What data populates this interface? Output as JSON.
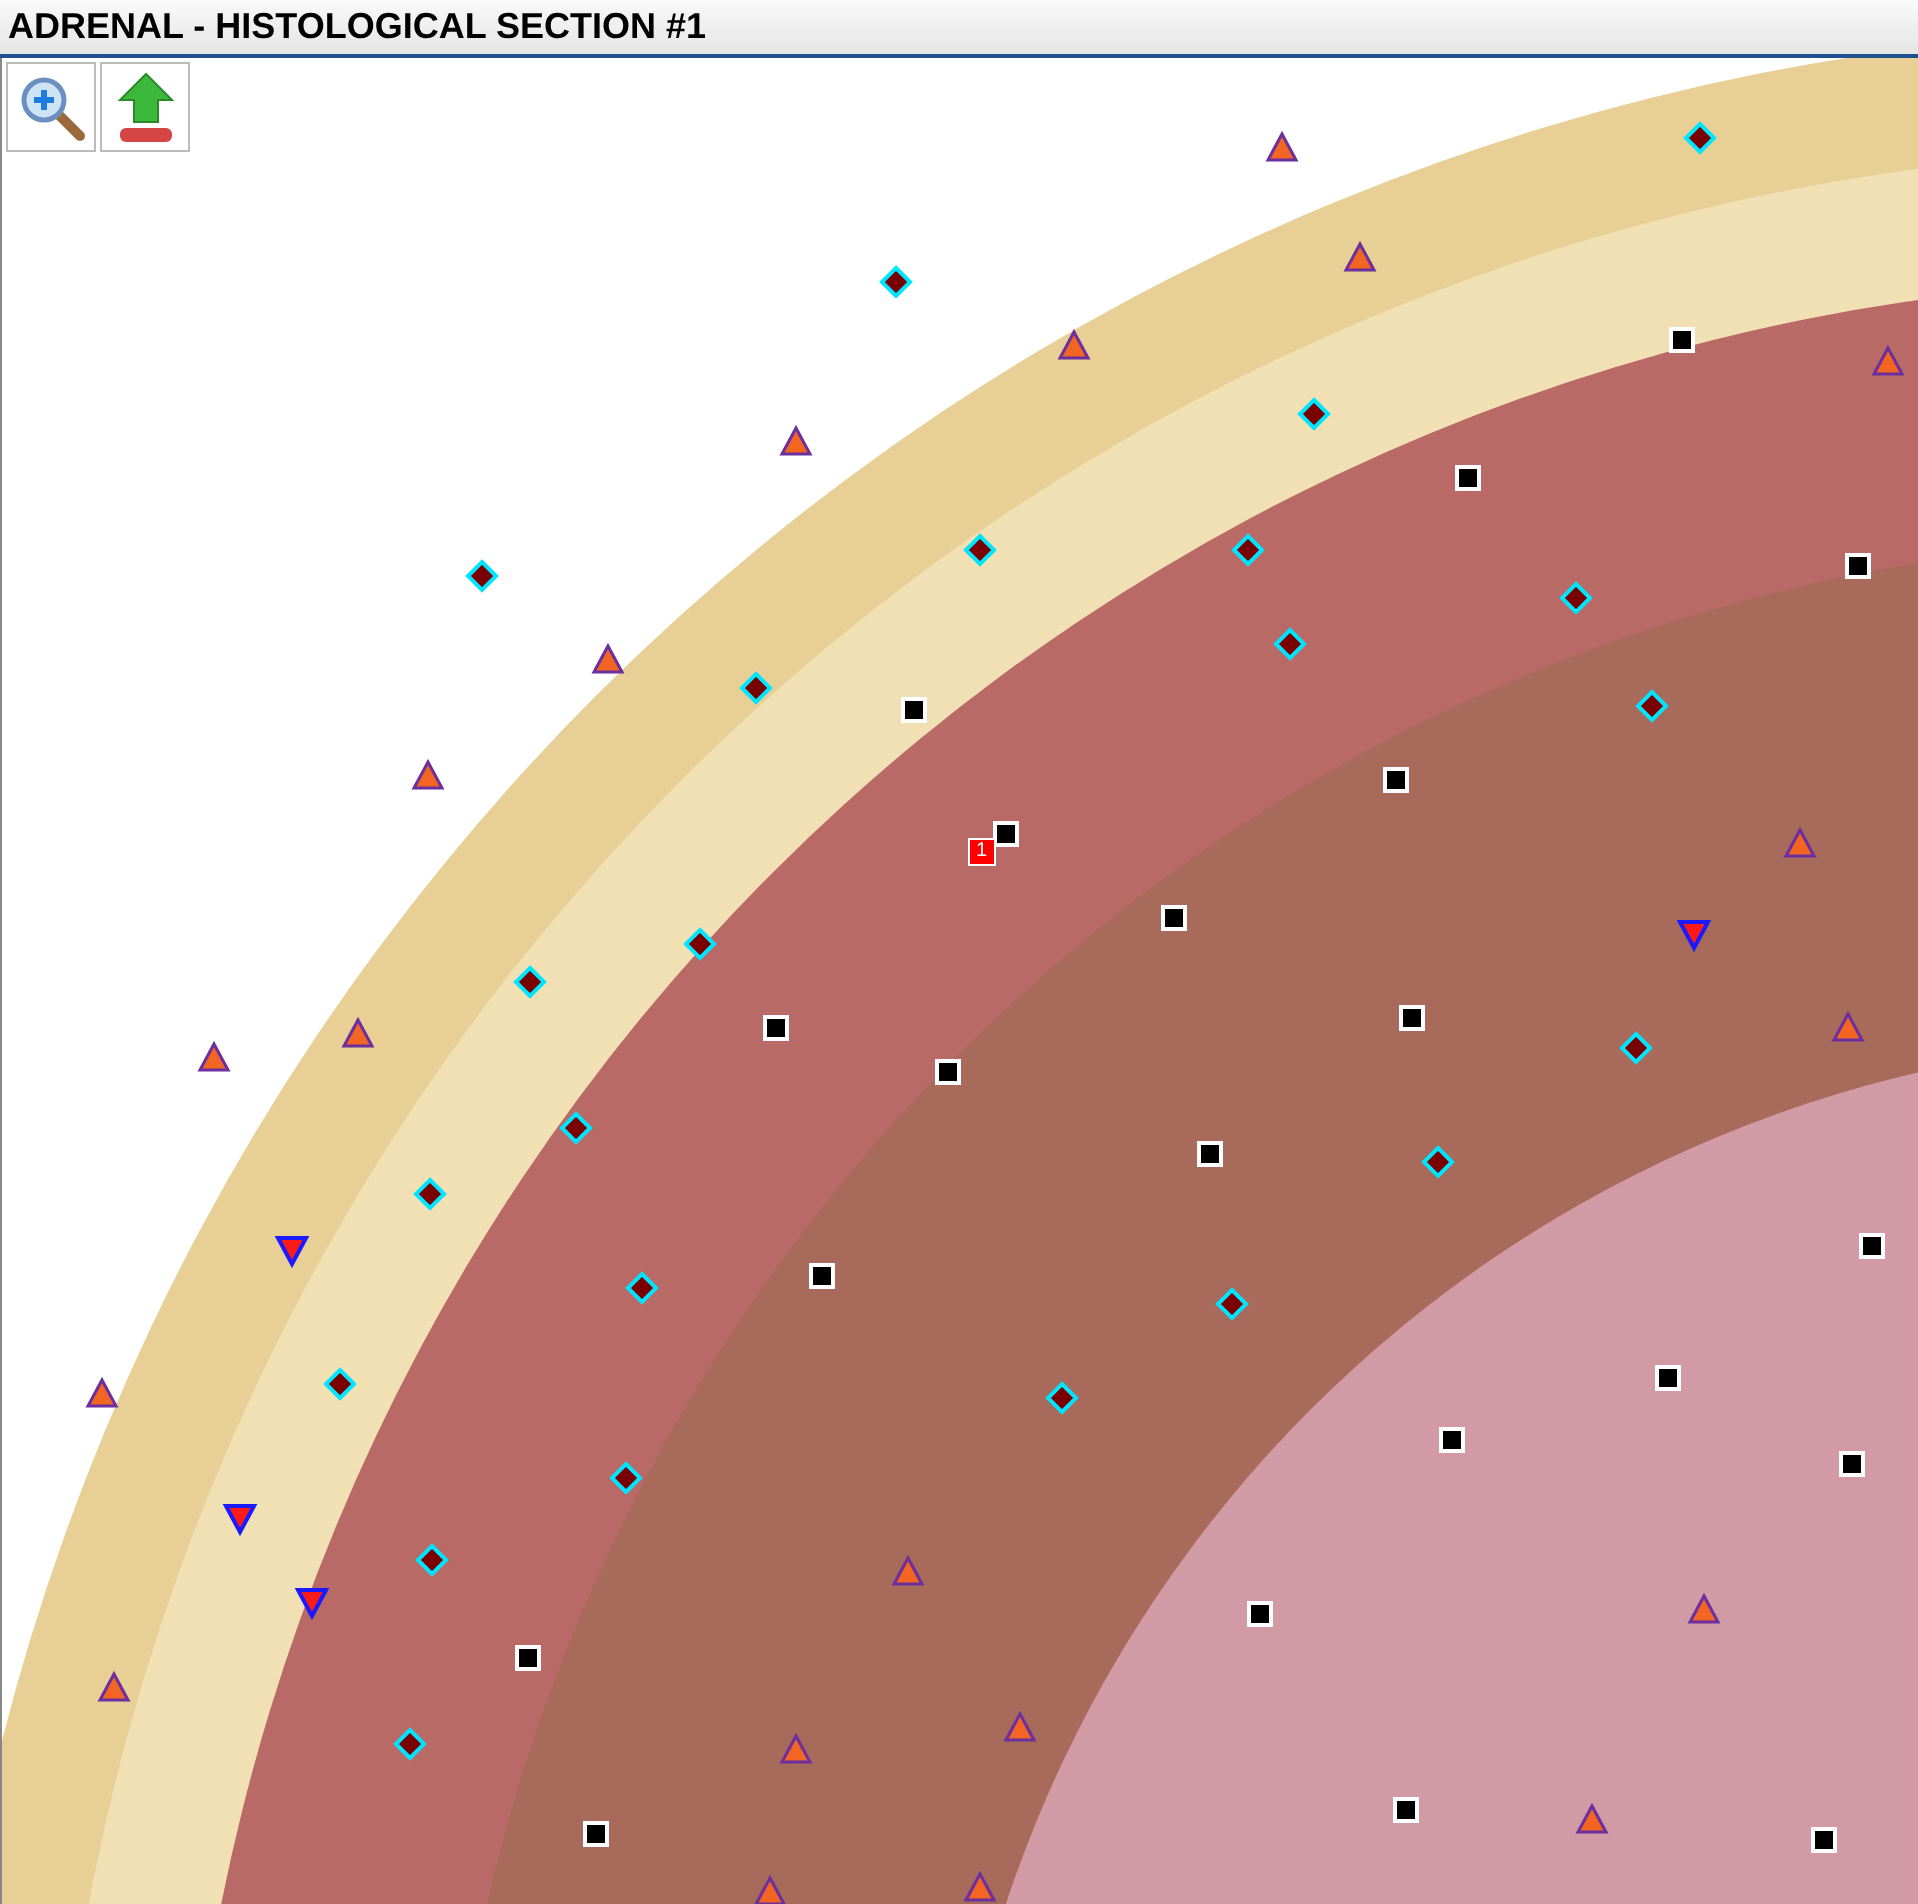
{
  "window": {
    "title": "ADRENAL - HISTOLOGICAL SECTION #1"
  },
  "toolbar": [
    {
      "kind": "zoom"
    },
    {
      "kind": "upload"
    }
  ],
  "badge": {
    "label": "1"
  },
  "markers": [
    {
      "kind": "triangle"
    },
    {
      "kind": "triangle"
    },
    {
      "kind": "triangle"
    },
    {
      "kind": "triangle"
    },
    {
      "kind": "triangle"
    },
    {
      "kind": "triangle"
    },
    {
      "kind": "triangle"
    },
    {
      "kind": "triangle"
    },
    {
      "kind": "triangle"
    },
    {
      "kind": "triangle"
    },
    {
      "kind": "triangle"
    },
    {
      "kind": "triangle"
    },
    {
      "kind": "triangle"
    },
    {
      "kind": "triangle"
    },
    {
      "kind": "triangle"
    },
    {
      "kind": "triangle"
    },
    {
      "kind": "triangle"
    },
    {
      "kind": "triangle"
    },
    {
      "kind": "triangle"
    },
    {
      "kind": "triangle"
    },
    {
      "kind": "diamond"
    },
    {
      "kind": "diamond"
    },
    {
      "kind": "diamond"
    },
    {
      "kind": "diamond"
    },
    {
      "kind": "diamond"
    },
    {
      "kind": "diamond"
    },
    {
      "kind": "diamond"
    },
    {
      "kind": "diamond"
    },
    {
      "kind": "diamond"
    },
    {
      "kind": "diamond"
    },
    {
      "kind": "diamond"
    },
    {
      "kind": "diamond"
    },
    {
      "kind": "diamond"
    },
    {
      "kind": "diamond"
    },
    {
      "kind": "diamond"
    },
    {
      "kind": "diamond"
    },
    {
      "kind": "diamond"
    },
    {
      "kind": "diamond"
    },
    {
      "kind": "diamond"
    },
    {
      "kind": "diamond"
    },
    {
      "kind": "diamond"
    },
    {
      "kind": "diamond"
    },
    {
      "kind": "diamond"
    },
    {
      "kind": "square"
    },
    {
      "kind": "square"
    },
    {
      "kind": "square"
    },
    {
      "kind": "square"
    },
    {
      "kind": "square"
    },
    {
      "kind": "square"
    },
    {
      "kind": "square"
    },
    {
      "kind": "square"
    },
    {
      "kind": "square"
    },
    {
      "kind": "square"
    },
    {
      "kind": "square"
    },
    {
      "kind": "square"
    },
    {
      "kind": "square"
    },
    {
      "kind": "square"
    },
    {
      "kind": "square"
    },
    {
      "kind": "square"
    },
    {
      "kind": "square"
    },
    {
      "kind": "square"
    },
    {
      "kind": "square"
    },
    {
      "kind": "square"
    },
    {
      "kind": "square"
    },
    {
      "kind": "down-triangle"
    },
    {
      "kind": "down-triangle"
    },
    {
      "kind": "down-triangle"
    },
    {
      "kind": "down-triangle"
    }
  ]
}
